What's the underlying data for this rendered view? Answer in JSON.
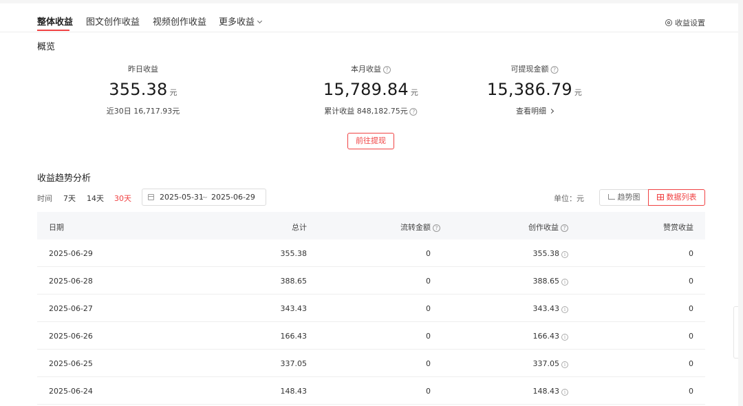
{
  "tabs": [
    {
      "label": "整体收益",
      "active": true
    },
    {
      "label": "图文创作收益",
      "active": false
    },
    {
      "label": "视频创作收益",
      "active": false
    },
    {
      "label": "更多收益",
      "active": false
    }
  ],
  "settings_label": "收益设置",
  "overview": {
    "title": "概览",
    "yesterday": {
      "label": "昨日收益",
      "value": "355.38",
      "unit": "元",
      "sub_label": "近30日",
      "sub_value": "16,717.93元"
    },
    "month": {
      "label": "本月收益",
      "value": "15,789.84",
      "unit": "元",
      "sub_label": "累计收益",
      "sub_value": "848,182.75元"
    },
    "withdrawable": {
      "label": "可提现金额",
      "value": "15,386.79",
      "unit": "元",
      "link": "查看明细"
    },
    "withdraw_button": "前往提现"
  },
  "trend": {
    "title": "收益趋势分析",
    "time_label": "时间",
    "ranges": [
      {
        "label": "7天",
        "active": false
      },
      {
        "label": "14天",
        "active": false
      },
      {
        "label": "30天",
        "active": true
      }
    ],
    "date_start": "2025-05-31",
    "date_sep": "~",
    "date_end": "2025-06-29",
    "unit_label": "单位：元",
    "view_trend": "趋势图",
    "view_list": "数据列表"
  },
  "table": {
    "headers": {
      "date": "日期",
      "total": "总计",
      "flow": "流转金额",
      "create": "创作收益",
      "reward": "赞赏收益"
    },
    "rows": [
      {
        "date": "2025-06-29",
        "total": "355.38",
        "flow": "0",
        "create": "355.38",
        "reward": "0"
      },
      {
        "date": "2025-06-28",
        "total": "388.65",
        "flow": "0",
        "create": "388.65",
        "reward": "0"
      },
      {
        "date": "2025-06-27",
        "total": "343.43",
        "flow": "0",
        "create": "343.43",
        "reward": "0"
      },
      {
        "date": "2025-06-26",
        "total": "166.43",
        "flow": "0",
        "create": "166.43",
        "reward": "0"
      },
      {
        "date": "2025-06-25",
        "total": "337.05",
        "flow": "0",
        "create": "337.05",
        "reward": "0"
      },
      {
        "date": "2025-06-24",
        "total": "148.43",
        "flow": "0",
        "create": "148.43",
        "reward": "0"
      }
    ]
  },
  "colors": {
    "accent": "#f04142",
    "header_bg": "#f6f7f9"
  }
}
